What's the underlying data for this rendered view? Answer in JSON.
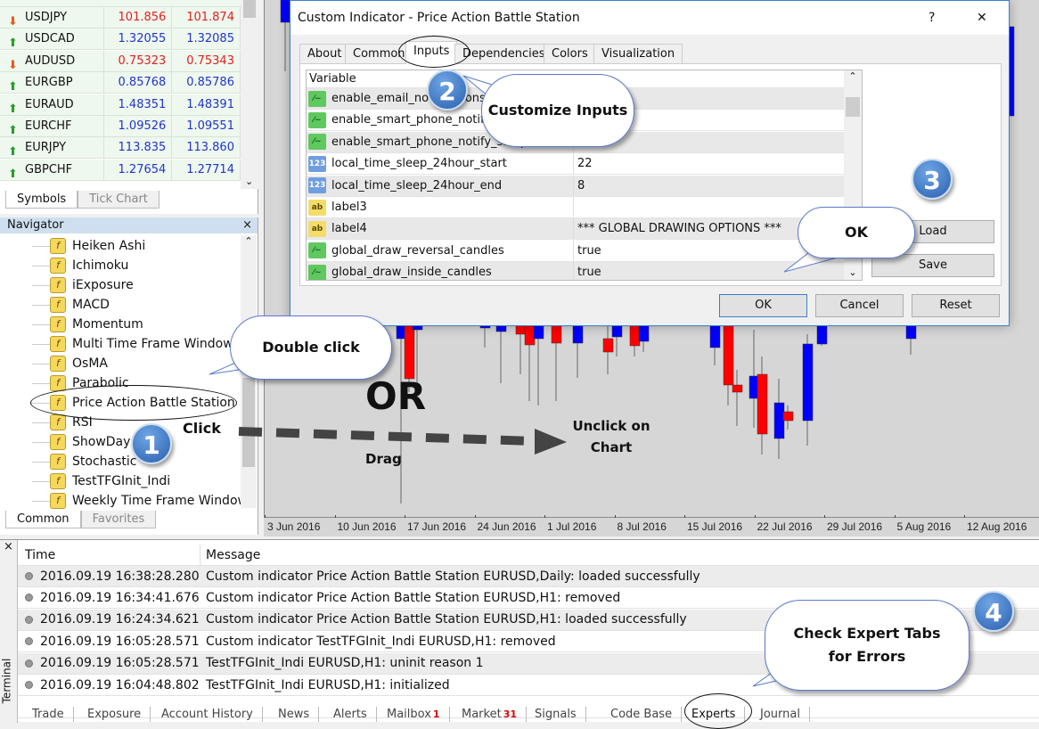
{
  "market_watch": {
    "rows": [
      {
        "symbol": "USDJPY",
        "bid": "101.856",
        "ask": "101.874",
        "dir": "down"
      },
      {
        "symbol": "USDCAD",
        "bid": "1.32055",
        "ask": "1.32085",
        "dir": "up"
      },
      {
        "symbol": "AUDUSD",
        "bid": "0.75323",
        "ask": "0.75343",
        "dir": "down"
      },
      {
        "symbol": "EURGBP",
        "bid": "0.85768",
        "ask": "0.85786",
        "dir": "up"
      },
      {
        "symbol": "EURAUD",
        "bid": "1.48351",
        "ask": "1.48391",
        "dir": "up"
      },
      {
        "symbol": "EURCHF",
        "bid": "1.09526",
        "ask": "1.09551",
        "dir": "up"
      },
      {
        "symbol": "EURJPY",
        "bid": "113.835",
        "ask": "113.860",
        "dir": "up"
      },
      {
        "symbol": "GBPCHF",
        "bid": "1.27654",
        "ask": "1.27714",
        "dir": "up"
      }
    ],
    "tabs": [
      "Symbols",
      "Tick Chart"
    ]
  },
  "navigator": {
    "title": "Navigator",
    "items": [
      "Heiken Ashi",
      "Ichimoku",
      "iExposure",
      "MACD",
      "Momentum",
      "Multi Time Frame Window",
      "OsMA",
      "Parabolic",
      "Price Action Battle Station",
      "RSI",
      "ShowDay",
      "Stochastic",
      "TestTFGInit_Indi",
      "Weekly Time Frame Window"
    ],
    "tabs": [
      "Common",
      "Favorites"
    ]
  },
  "chart": {
    "dates": [
      "3 Jun 2016",
      "10 Jun 2016",
      "17 Jun 2016",
      "24 Jun 2016",
      "1 Jul 2016",
      "8 Jul 2016",
      "15 Jul 2016",
      "22 Jul 2016",
      "29 Jul 2016",
      "5 Aug 2016",
      "12 Aug 2016"
    ],
    "up_color": "#0000ff",
    "down_color": "#ff0000"
  },
  "dialog": {
    "title": "Custom Indicator - Price Action Battle Station",
    "help": "?",
    "close": "✕",
    "tabs": [
      "About",
      "Common",
      "Inputs",
      "Dependencies",
      "Colors",
      "Visualization"
    ],
    "column_variable": "Variable",
    "rows": [
      {
        "type": "bool",
        "name": "enable_email_notifications",
        "value": ""
      },
      {
        "type": "bool",
        "name": "enable_smart_phone_notifications",
        "value": ""
      },
      {
        "type": "bool",
        "name": "enable_smart_phone_notify_sleep",
        "value": ""
      },
      {
        "type": "int",
        "name": "local_time_sleep_24hour_start",
        "value": "22"
      },
      {
        "type": "int",
        "name": "local_time_sleep_24hour_end",
        "value": "8"
      },
      {
        "type": "str",
        "name": "label3",
        "value": ""
      },
      {
        "type": "str",
        "name": "label4",
        "value": "*** GLOBAL DRAWING OPTIONS ***"
      },
      {
        "type": "bool",
        "name": "global_draw_reversal_candles",
        "value": "true"
      },
      {
        "type": "bool",
        "name": "global_draw_inside_candles",
        "value": "true"
      }
    ],
    "load": "Load",
    "save": "Save",
    "ok": "OK",
    "cancel": "Cancel",
    "reset": "Reset"
  },
  "terminal": {
    "label": "Terminal",
    "close": "×",
    "col_time": "Time",
    "col_message": "Message",
    "rows": [
      {
        "time": "2016.09.19 16:38:28.280",
        "message": "Custom indicator Price Action Battle Station EURUSD,Daily: loaded successfully"
      },
      {
        "time": "2016.09.19 16:34:41.676",
        "message": "Custom indicator Price Action Battle Station EURUSD,H1: removed"
      },
      {
        "time": "2016.09.19 16:24:34.621",
        "message": "Custom indicator Price Action Battle Station EURUSD,H1: loaded successfully"
      },
      {
        "time": "2016.09.19 16:05:28.571",
        "message": "Custom indicator TestTFGInit_Indi EURUSD,H1: removed"
      },
      {
        "time": "2016.09.19 16:05:28.571",
        "message": "TestTFGInit_Indi EURUSD,H1: uninit reason 1"
      },
      {
        "time": "2016.09.19 16:04:48.802",
        "message": "TestTFGInit_Indi EURUSD,H1: initialized"
      }
    ],
    "tabs": [
      {
        "label": "Trade"
      },
      {
        "label": "Exposure"
      },
      {
        "label": "Account History"
      },
      {
        "label": "News"
      },
      {
        "label": "Alerts"
      },
      {
        "label": "Mailbox",
        "badge": "1"
      },
      {
        "label": "Market",
        "badge": "31"
      },
      {
        "label": "Signals"
      },
      {
        "label": "Code Base"
      },
      {
        "label": "Experts"
      },
      {
        "label": "Journal"
      }
    ]
  },
  "annotations": {
    "step1": "1",
    "step2": "2",
    "step3": "3",
    "step4": "4",
    "customize": "Customize Inputs",
    "ok": "OK",
    "double_click": "Double click",
    "or": "OR",
    "click": "Click",
    "drag": "Drag",
    "unclick": "Unclick on Chart",
    "check": "Check Expert Tabs for Errors"
  }
}
